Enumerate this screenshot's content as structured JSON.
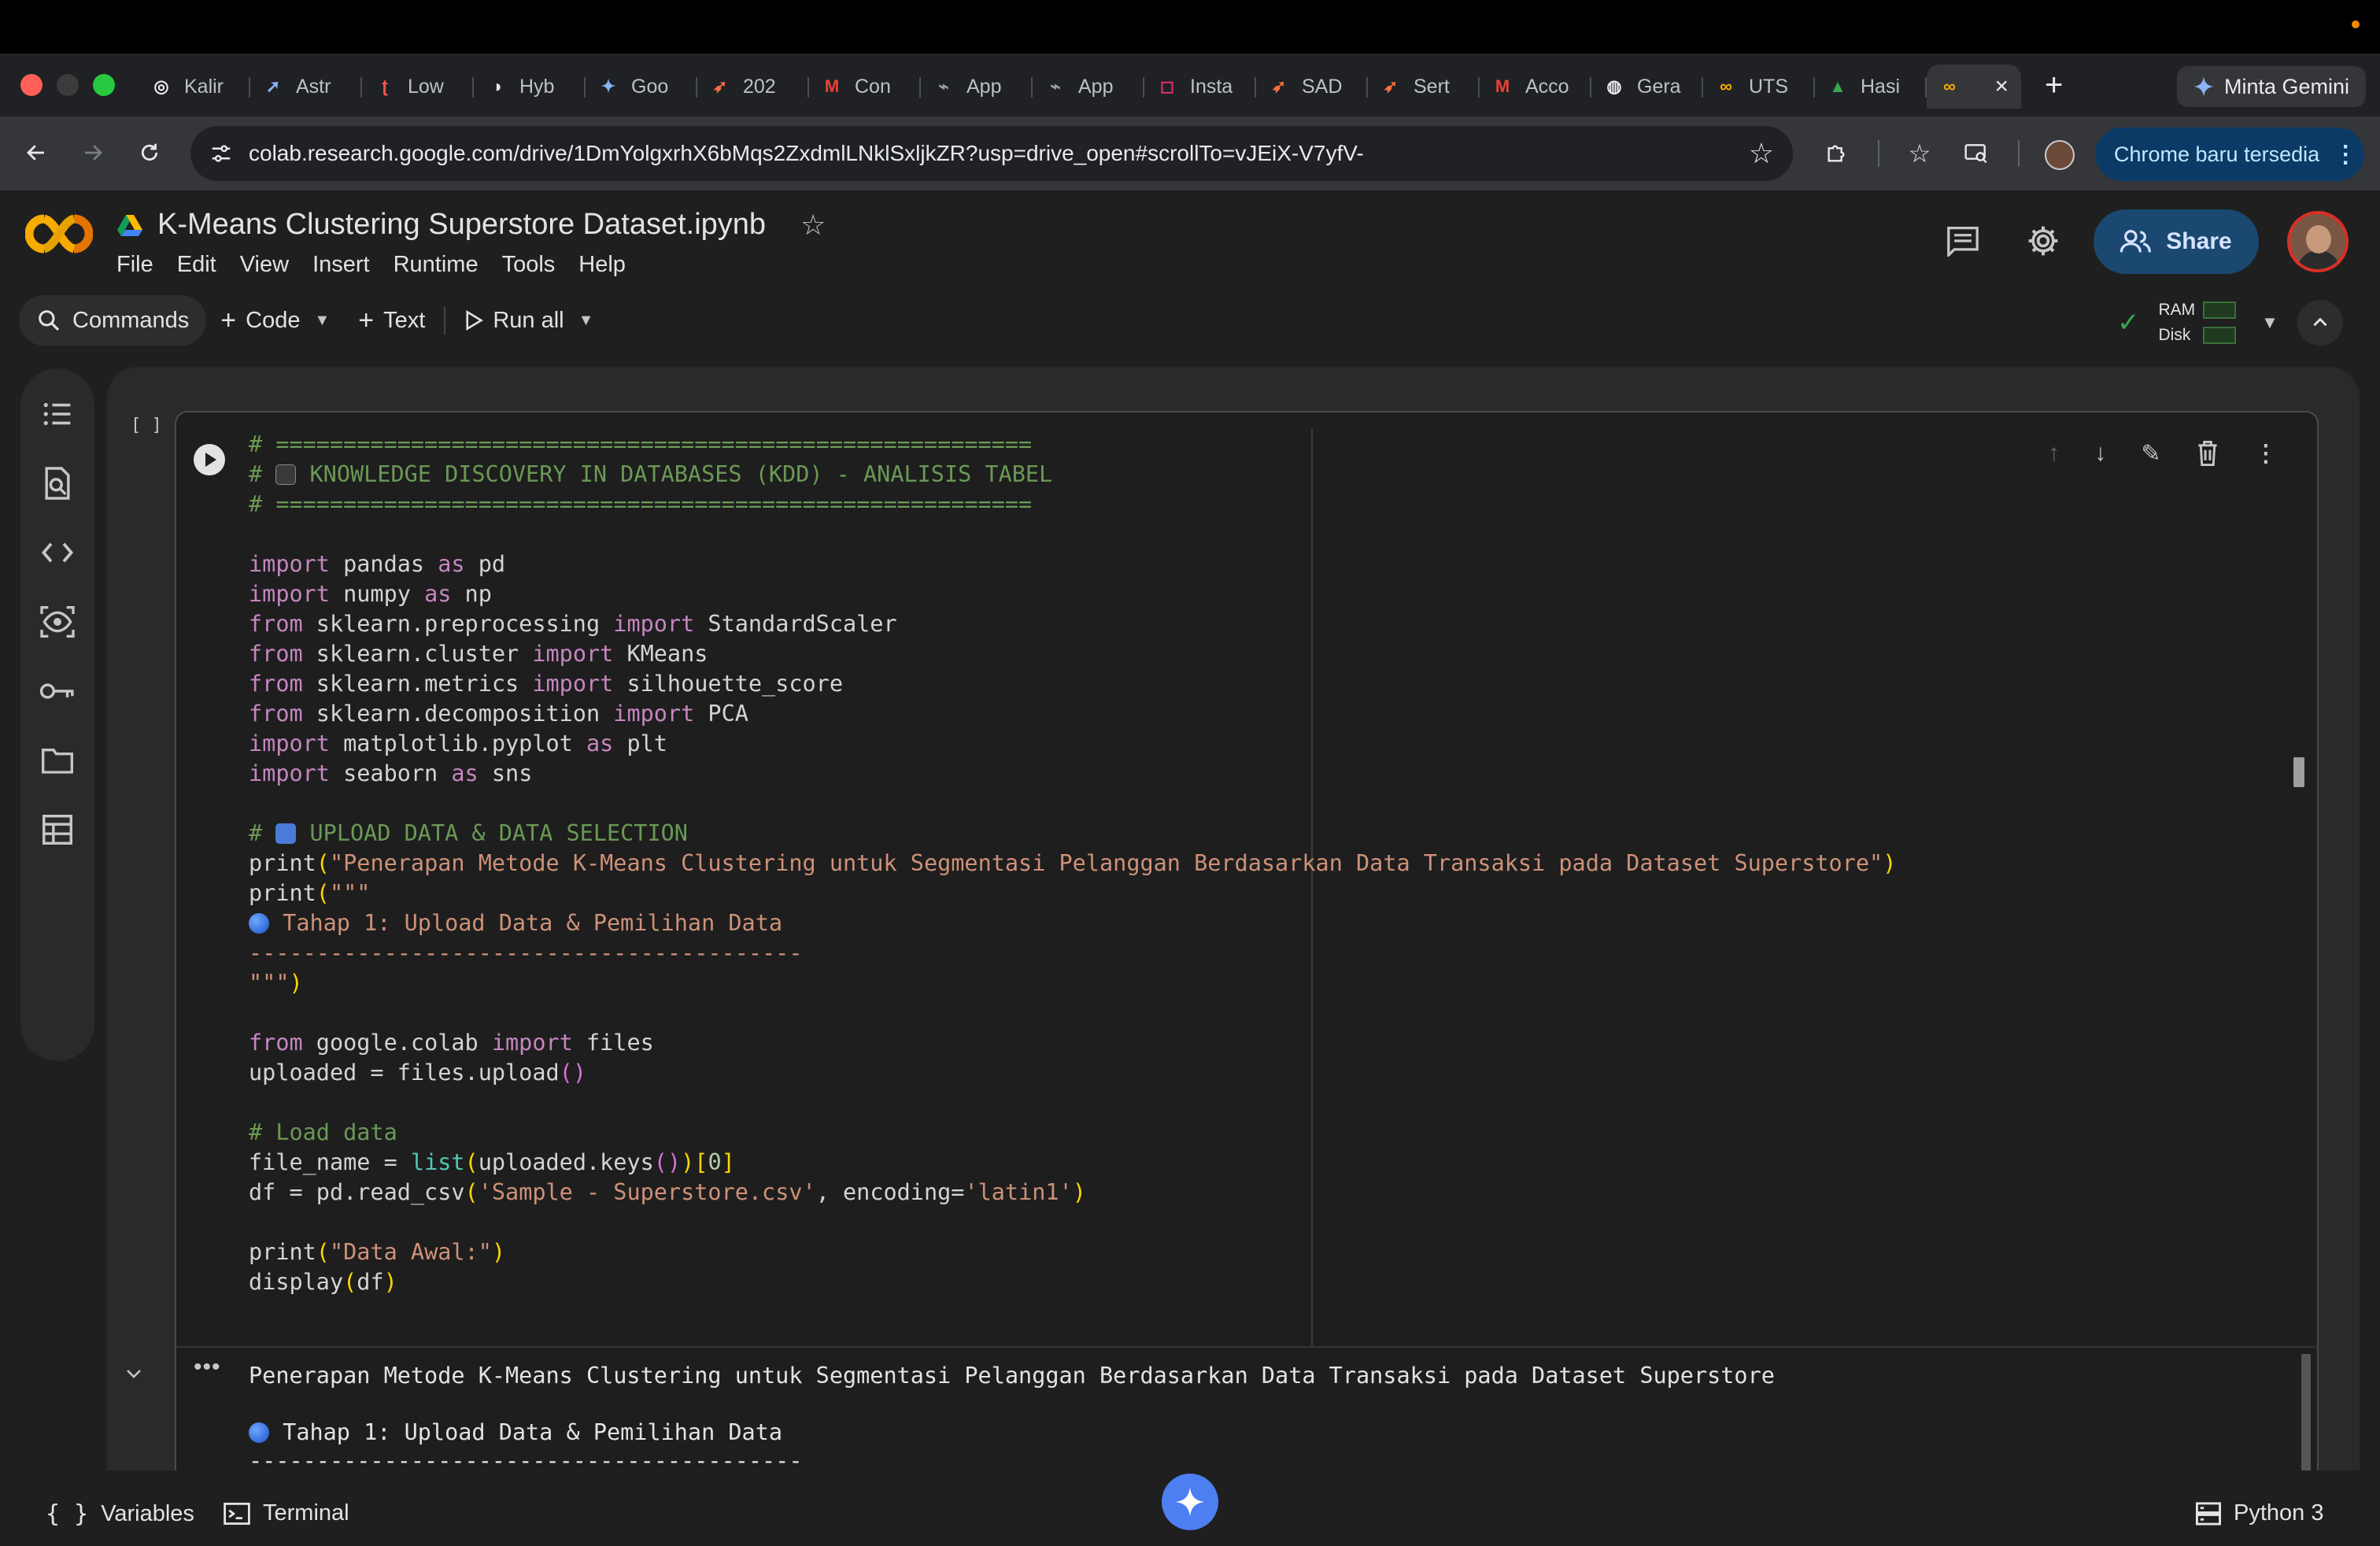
{
  "browser": {
    "tabs": [
      {
        "label": "Kalir",
        "icon": "openai-icon",
        "color": "#e8eaed"
      },
      {
        "label": "Astr",
        "icon": "astro-icon",
        "color": "#8ab4f8"
      },
      {
        "label": "Low",
        "icon": "low-icon",
        "color": "#ff5252"
      },
      {
        "label": "Hyb",
        "icon": "hybrid-icon",
        "color": "#e8eaed"
      },
      {
        "label": "Goo",
        "icon": "gemini-icon",
        "color": "#8ab4f8"
      },
      {
        "label": "202",
        "icon": "plane-icon",
        "color": "#ff7043"
      },
      {
        "label": "Con",
        "icon": "gmail-icon",
        "color": "#ea4335"
      },
      {
        "label": "App",
        "icon": "app-icon",
        "color": "#9aa0a6"
      },
      {
        "label": "App",
        "icon": "app-icon",
        "color": "#9aa0a6"
      },
      {
        "label": "Insta",
        "icon": "instagram-icon",
        "color": "#e1306c"
      },
      {
        "label": "SAD",
        "icon": "plane-icon",
        "color": "#ff7043"
      },
      {
        "label": "Sert",
        "icon": "plane-icon",
        "color": "#ff7043"
      },
      {
        "label": "Acco",
        "icon": "gmail-icon",
        "color": "#ea4335"
      },
      {
        "label": "Gera",
        "icon": "globe-icon",
        "color": "#e8eaed"
      },
      {
        "label": "UTS",
        "icon": "colab-icon",
        "color": "#f9ab00"
      },
      {
        "label": "Hasi",
        "icon": "drive-icon",
        "color": "#34a853"
      }
    ],
    "active_tab_icon": "colab-icon",
    "new_tab_label": "+",
    "gemini_button": "Minta Gemini",
    "url": "colab.research.google.com/drive/1DmYolgxrhX6bMqs2ZxdmlLNklSxljkZR?usp=drive_open#scrollTo=vJEiX-V7yfV-",
    "update_chip": "Chrome baru tersedia"
  },
  "colab": {
    "title": "K-Means Clustering Superstore Dataset.ipynb",
    "menu": [
      "File",
      "Edit",
      "View",
      "Insert",
      "Runtime",
      "Tools",
      "Help"
    ],
    "share_label": "Share",
    "toolbar": {
      "commands": "Commands",
      "code": "Code",
      "text": "Text",
      "run_all": "Run all"
    },
    "resources": {
      "ram": "RAM",
      "disk": "Disk"
    },
    "cell_bracket": "[ ]",
    "code_cell": {
      "banner_rule": "# ========================================================",
      "banner_title": "KNOWLEDGE DISCOVERY IN DATABASES (KDD) - ANALISIS TABEL",
      "step1_comment": "UPLOAD DATA & DATA SELECTION",
      "print_title": "\"Penerapan Metode K-Means Clustering untuk Segmentasi Pelanggan Berdasarkan Data Transaksi pada Dataset Superstore\"",
      "stage_line": "Tahap 1: Upload Data & Pemilihan Data",
      "dash_line": "-----------------------------------------",
      "load_comment": "# Load data",
      "csv_name": "'Sample - Superstore.csv'",
      "encoding": "'latin1'",
      "print_awal": "\"Data Awal:\""
    },
    "output": {
      "line1": "Penerapan Metode K-Means Clustering untuk Segmentasi Pelanggan Berdasarkan Data Transaksi pada Dataset Superstore",
      "line2": "Tahap 1: Upload Data & Pemilihan Data",
      "line3": "-----------------------------------------"
    },
    "status": {
      "variables": "Variables",
      "terminal": "Terminal",
      "runtime": "Python 3"
    }
  }
}
